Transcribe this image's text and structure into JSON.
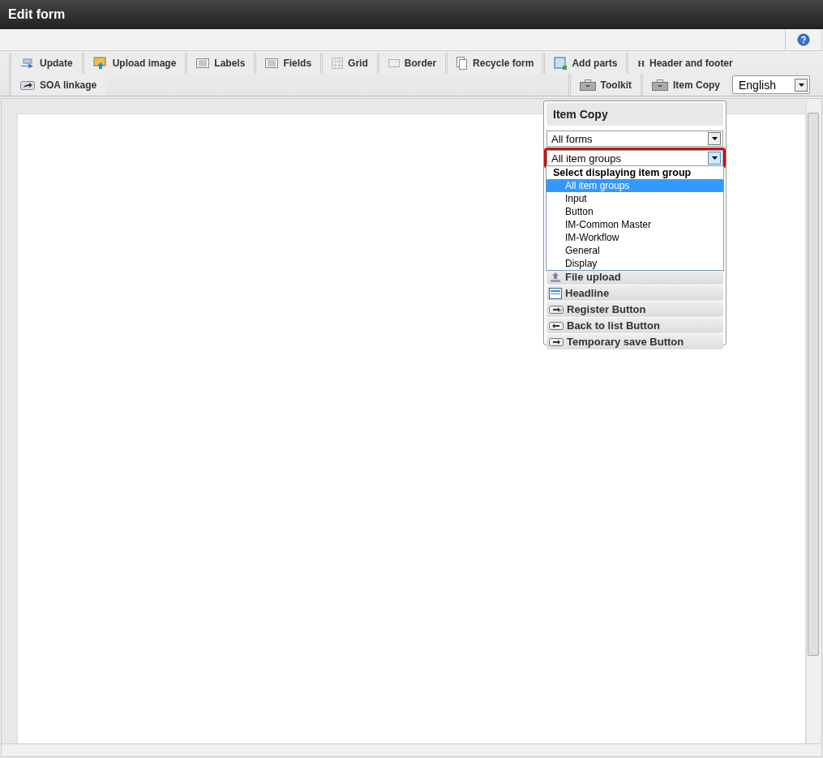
{
  "window": {
    "title": "Edit form"
  },
  "tabs_row1": [
    {
      "label": "Update"
    },
    {
      "label": "Upload image"
    },
    {
      "label": "Labels"
    },
    {
      "label": "Fields"
    },
    {
      "label": "Grid"
    },
    {
      "label": "Border"
    },
    {
      "label": "Recycle form"
    },
    {
      "label": "Add parts"
    },
    {
      "label": "Header and footer",
      "icon_text": "H"
    }
  ],
  "tabs_row2_left": [
    {
      "label": "SOA linkage"
    }
  ],
  "tabs_row2_right": [
    {
      "label": "Toolkit"
    },
    {
      "label": "Item Copy"
    }
  ],
  "language_select": {
    "value": "English"
  },
  "item_copy_panel": {
    "title": "Item Copy",
    "form_select": {
      "value": "All forms"
    },
    "group_select": {
      "value": "All item groups",
      "expanded": true,
      "highlighted": true
    },
    "dropdown": {
      "group_label": "Select displaying item group",
      "options": [
        {
          "label": "All item groups",
          "selected": true
        },
        {
          "label": "Input",
          "selected": false
        },
        {
          "label": "Button",
          "selected": false
        },
        {
          "label": "IM-Common Master",
          "selected": false
        },
        {
          "label": "IM-Workflow",
          "selected": false
        },
        {
          "label": "General",
          "selected": false
        },
        {
          "label": "Display",
          "selected": false
        }
      ]
    },
    "items": [
      {
        "label": "File upload",
        "kind": "upload"
      },
      {
        "label": "Headline",
        "kind": "headline"
      },
      {
        "label": "Register Button",
        "kind": "register"
      },
      {
        "label": "Back to list Button",
        "kind": "back"
      },
      {
        "label": "Temporary save Button",
        "kind": "save"
      }
    ]
  }
}
